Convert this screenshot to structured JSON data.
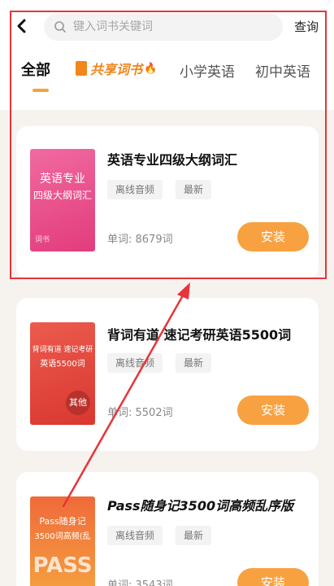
{
  "header": {
    "search_placeholder": "键入词书关键词",
    "query_label": "查询"
  },
  "tabs": [
    "全部",
    "共享词书",
    "小学英语",
    "初中英语"
  ],
  "active_tab": "全部",
  "cards": [
    {
      "title": "英语专业四级大纲词汇",
      "cover_text": [
        "英语专业",
        "四级大纲词汇"
      ],
      "cover_footer": "词书",
      "tags": [
        "离线音频",
        "最新"
      ],
      "word_count": "单词: 8679词",
      "button": "安装"
    },
    {
      "title": "背词有道 速记考研英语5500词",
      "cover_text": [
        "背词有道 速记考研",
        "英语5500词"
      ],
      "cover_badge": "其他",
      "tags": [
        "离线音频",
        "最新"
      ],
      "word_count": "单词: 5502词",
      "button": "安装"
    },
    {
      "title": "Pass随身记3500词高频乱序版",
      "cover_text": [
        "Pass随身记",
        "3500词高频(乱"
      ],
      "cover_big": "PASS",
      "tags": [
        "离线音频",
        "最新"
      ],
      "word_count": "单词: 3543词",
      "button": "安装"
    }
  ],
  "colors": {
    "accent": "#f8a141",
    "shared_tab": "#f0861c",
    "annotation": "#e7343a",
    "cover_pink": "#ea4a86",
    "cover_red": "#e2463d",
    "cover_orange": "#f27c36"
  }
}
